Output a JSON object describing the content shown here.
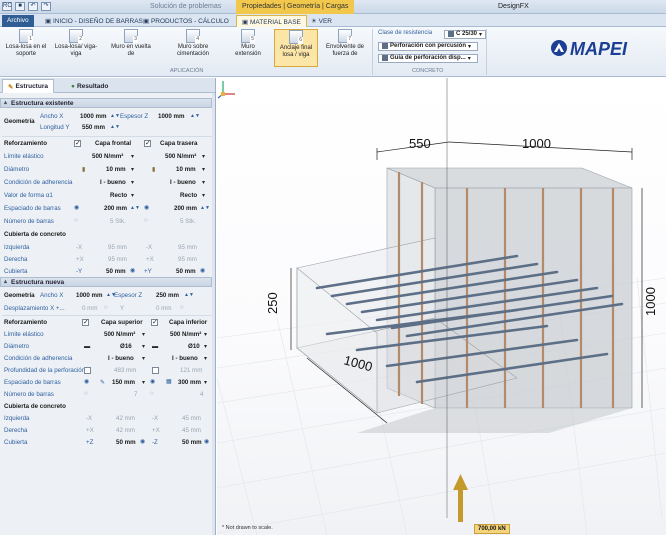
{
  "titlebar": {
    "qat_buttons": [
      "RC",
      "save",
      "undo",
      "redo"
    ],
    "left_text": "Solución de problemas",
    "context_tools": "Propiedades | Geometría | Cargas",
    "app_title": "DesignFX"
  },
  "tabs": [
    {
      "label": "Archivo"
    },
    {
      "label": "INICIO - DISEÑO DE BARRAS"
    },
    {
      "label": "PRODUCTOS - CÁLCULO"
    },
    {
      "label": "MATERIAL BASE"
    },
    {
      "label": "VER"
    }
  ],
  "ribbon": {
    "buttons": [
      {
        "num": "1",
        "label": "Losa-losa en el soporte"
      },
      {
        "num": "2",
        "label": "Losa-losa/ viga-viga"
      },
      {
        "num": "3",
        "label": "Muro en vuelta de"
      },
      {
        "num": "4",
        "label": "Muro sobre cimentación"
      },
      {
        "num": "5",
        "label": "Muro extensión"
      },
      {
        "num": "6",
        "label": "Anclaje final losa / viga"
      },
      {
        "num": "7",
        "label": "Envolvente de fuerza de"
      }
    ],
    "group_aplicacion": "APLICACIÓN",
    "group_concreto": "CONCRETO",
    "concrete_class_label": "Clase de resistencia",
    "concrete_class_value": "C 25/30",
    "drilling_value": "Perforación con percusión",
    "guide_value": "Guía de perforación disp..."
  },
  "brand": {
    "name": "MAPEI",
    "color": "#1c3f95"
  },
  "panel": {
    "tabs": [
      "Estructura",
      "Resultado"
    ],
    "existing": {
      "title": "Estructura existente",
      "geometry_label": "Geometría",
      "width_x_label": "Ancho X",
      "width_x_value": "1000 mm",
      "thickness_z_label": "Espesor Z",
      "thickness_z_value": "1000 mm",
      "length_y_label": "Longitud Y",
      "length_y_value": "550 mm",
      "reinforcement_label": "Reforzamiento",
      "col_front": "Capa frontal",
      "col_back": "Capa trasera",
      "rows": [
        {
          "label": "Límite elástico",
          "front": "500 N/mm²",
          "back": "500 N/mm²"
        },
        {
          "label": "Diámetro",
          "front": "10 mm",
          "back": "10 mm"
        },
        {
          "label": "Condición de adherencia",
          "front": "I - bueno",
          "back": "I - bueno"
        },
        {
          "label": "Valor de forma α1",
          "front": "Recto",
          "back": "Recto"
        },
        {
          "label": "Espaciado de barras",
          "front": "200 mm",
          "back": "200 mm"
        },
        {
          "label": "Número de barras",
          "front": "5 Stk.",
          "back": "5 Stk."
        }
      ],
      "cover_label": "Cubierta de concreto",
      "cover_rows": [
        {
          "label": "Izquierda",
          "s1": "-X",
          "v1": "95 mm",
          "s2": "-X",
          "v2": "95 mm"
        },
        {
          "label": "Derecha",
          "s1": "+X",
          "v1": "95 mm",
          "s2": "+X",
          "v2": "95 mm"
        },
        {
          "label": "Cubierta",
          "s1": "-Y",
          "v1": "50 mm",
          "s2": "+Y",
          "v2": "50 mm"
        }
      ]
    },
    "new": {
      "title": "Estructura nueva",
      "geometry_label": "Geometría",
      "width_x_label": "Ancho X",
      "width_x_value": "1000 mm",
      "thickness_z_label": "Espesor Z",
      "thickness_z_value": "250 mm",
      "disp_label": "Desplazamiento  X +...",
      "disp_x": "0 mm",
      "disp_y_label": "Y",
      "disp_y": "0 mm",
      "reinforcement_label": "Reforzamiento",
      "col_top": "Capa superior",
      "col_bottom": "Capa inferior",
      "rows": [
        {
          "label": "Límite elástico",
          "top": "500 N/mm²",
          "bottom": "500 N/mm²"
        },
        {
          "label": "Diámetro",
          "top": "Ø16",
          "bottom": "Ø10"
        },
        {
          "label": "Condición de adherencia",
          "top": "I - bueno",
          "bottom": "I - bueno"
        },
        {
          "label": "Profundidad de la perforación",
          "top": "483 mm",
          "bottom": "121 mm"
        },
        {
          "label": "Espaciado de barras",
          "top": "150 mm",
          "bottom": "300 mm"
        },
        {
          "label": "Número de barras",
          "top": "7",
          "bottom": "4"
        }
      ],
      "cover_label": "Cubierta de concreto",
      "cover_rows": [
        {
          "label": "Izquierda",
          "s1": "-X",
          "v1": "42 mm",
          "s2": "-X",
          "v2": "45 mm"
        },
        {
          "label": "Derecha",
          "s1": "+X",
          "v1": "42 mm",
          "s2": "+X",
          "v2": "45 mm"
        },
        {
          "label": "Cubierta",
          "s1": "+Z",
          "v1": "50 mm",
          "s2": "-Z",
          "v2": "50 mm"
        }
      ]
    }
  },
  "viewport": {
    "dims": {
      "top_left": "550",
      "top_right": "1000",
      "left_height": "250",
      "right_height": "1000",
      "bottom": "1000"
    },
    "force_label": "700,00 kN",
    "note": "* Not drawn to scale."
  }
}
